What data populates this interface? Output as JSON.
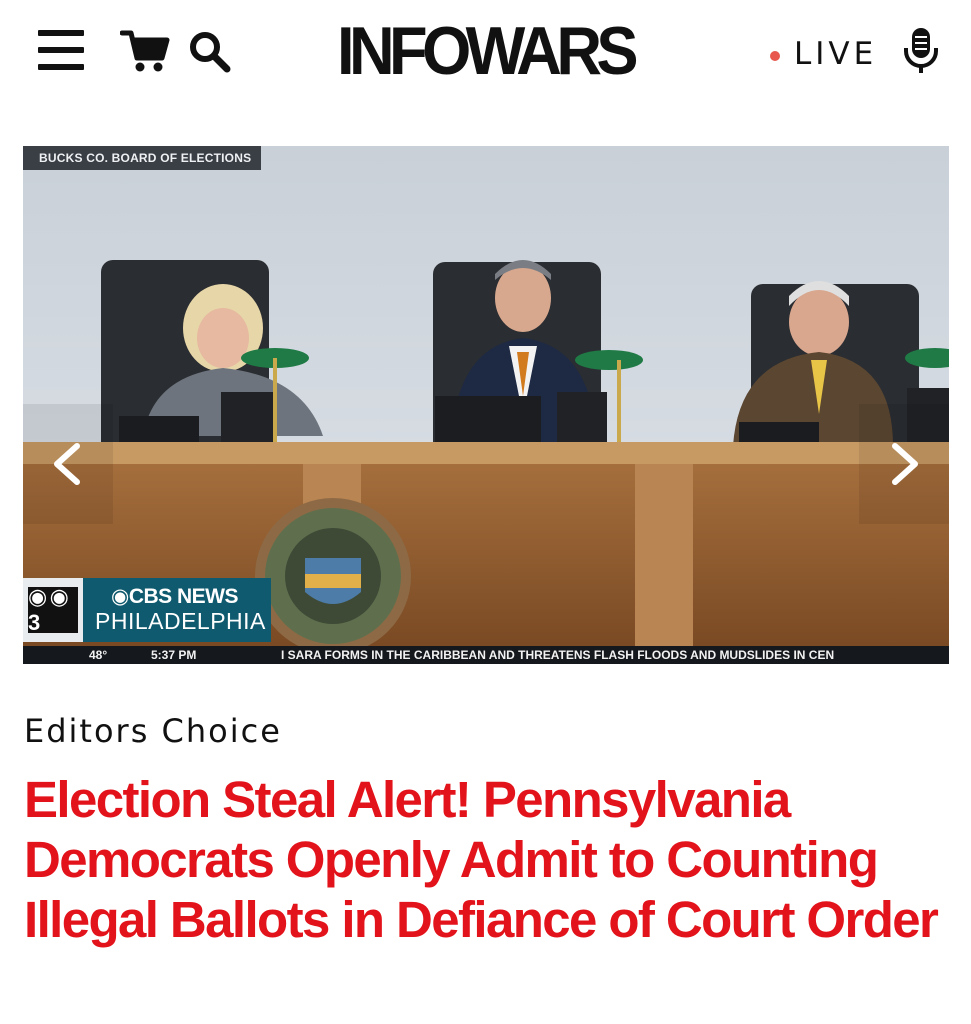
{
  "header": {
    "logo_text": "INFOWARS",
    "live_label": "LIVE",
    "icons": {
      "menu": "hamburger-menu-icon",
      "cart": "shopping-cart-icon",
      "search": "search-icon",
      "mic": "microphone-icon"
    },
    "live_dot_color": "#e8574e"
  },
  "media": {
    "source_tag": "BUCKS CO. BOARD OF ELECTIONS",
    "network_badge": "◉ ◉ 3",
    "network_name": "◉CBS NEWS",
    "network_city": "PHILADELPHIA",
    "ticker": {
      "temperature": "48°",
      "time": "5:37 PM",
      "crawl": "I SARA FORMS IN THE CARIBBEAN AND THREATENS FLASH FLOODS AND MUDSLIDES IN CEN"
    },
    "icons": {
      "prev": "chevron-left-icon",
      "next": "chevron-right-icon"
    }
  },
  "article": {
    "section": "Editors Choice",
    "headline": "Election Steal Alert! Pennsylvania Democrats Openly Admit to Counting Illegal Ballots in Defiance of Court Order",
    "headline_color": "#e3131b"
  }
}
